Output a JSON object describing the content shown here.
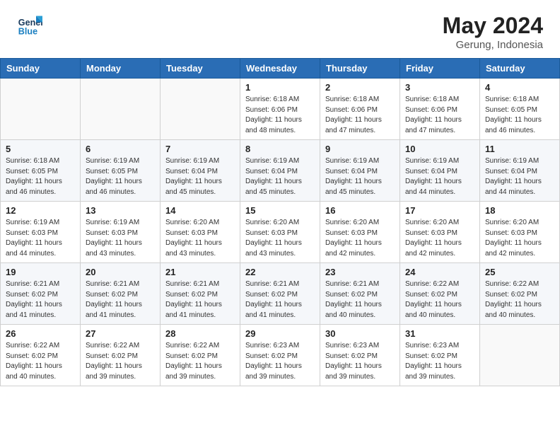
{
  "header": {
    "logo_line1": "General",
    "logo_line2": "Blue",
    "month_year": "May 2024",
    "location": "Gerung, Indonesia"
  },
  "weekdays": [
    "Sunday",
    "Monday",
    "Tuesday",
    "Wednesday",
    "Thursday",
    "Friday",
    "Saturday"
  ],
  "weeks": [
    [
      {
        "day": "",
        "info": ""
      },
      {
        "day": "",
        "info": ""
      },
      {
        "day": "",
        "info": ""
      },
      {
        "day": "1",
        "info": "Sunrise: 6:18 AM\nSunset: 6:06 PM\nDaylight: 11 hours\nand 48 minutes."
      },
      {
        "day": "2",
        "info": "Sunrise: 6:18 AM\nSunset: 6:06 PM\nDaylight: 11 hours\nand 47 minutes."
      },
      {
        "day": "3",
        "info": "Sunrise: 6:18 AM\nSunset: 6:06 PM\nDaylight: 11 hours\nand 47 minutes."
      },
      {
        "day": "4",
        "info": "Sunrise: 6:18 AM\nSunset: 6:05 PM\nDaylight: 11 hours\nand 46 minutes."
      }
    ],
    [
      {
        "day": "5",
        "info": "Sunrise: 6:18 AM\nSunset: 6:05 PM\nDaylight: 11 hours\nand 46 minutes."
      },
      {
        "day": "6",
        "info": "Sunrise: 6:19 AM\nSunset: 6:05 PM\nDaylight: 11 hours\nand 46 minutes."
      },
      {
        "day": "7",
        "info": "Sunrise: 6:19 AM\nSunset: 6:04 PM\nDaylight: 11 hours\nand 45 minutes."
      },
      {
        "day": "8",
        "info": "Sunrise: 6:19 AM\nSunset: 6:04 PM\nDaylight: 11 hours\nand 45 minutes."
      },
      {
        "day": "9",
        "info": "Sunrise: 6:19 AM\nSunset: 6:04 PM\nDaylight: 11 hours\nand 45 minutes."
      },
      {
        "day": "10",
        "info": "Sunrise: 6:19 AM\nSunset: 6:04 PM\nDaylight: 11 hours\nand 44 minutes."
      },
      {
        "day": "11",
        "info": "Sunrise: 6:19 AM\nSunset: 6:04 PM\nDaylight: 11 hours\nand 44 minutes."
      }
    ],
    [
      {
        "day": "12",
        "info": "Sunrise: 6:19 AM\nSunset: 6:03 PM\nDaylight: 11 hours\nand 44 minutes."
      },
      {
        "day": "13",
        "info": "Sunrise: 6:19 AM\nSunset: 6:03 PM\nDaylight: 11 hours\nand 43 minutes."
      },
      {
        "day": "14",
        "info": "Sunrise: 6:20 AM\nSunset: 6:03 PM\nDaylight: 11 hours\nand 43 minutes."
      },
      {
        "day": "15",
        "info": "Sunrise: 6:20 AM\nSunset: 6:03 PM\nDaylight: 11 hours\nand 43 minutes."
      },
      {
        "day": "16",
        "info": "Sunrise: 6:20 AM\nSunset: 6:03 PM\nDaylight: 11 hours\nand 42 minutes."
      },
      {
        "day": "17",
        "info": "Sunrise: 6:20 AM\nSunset: 6:03 PM\nDaylight: 11 hours\nand 42 minutes."
      },
      {
        "day": "18",
        "info": "Sunrise: 6:20 AM\nSunset: 6:03 PM\nDaylight: 11 hours\nand 42 minutes."
      }
    ],
    [
      {
        "day": "19",
        "info": "Sunrise: 6:21 AM\nSunset: 6:02 PM\nDaylight: 11 hours\nand 41 minutes."
      },
      {
        "day": "20",
        "info": "Sunrise: 6:21 AM\nSunset: 6:02 PM\nDaylight: 11 hours\nand 41 minutes."
      },
      {
        "day": "21",
        "info": "Sunrise: 6:21 AM\nSunset: 6:02 PM\nDaylight: 11 hours\nand 41 minutes."
      },
      {
        "day": "22",
        "info": "Sunrise: 6:21 AM\nSunset: 6:02 PM\nDaylight: 11 hours\nand 41 minutes."
      },
      {
        "day": "23",
        "info": "Sunrise: 6:21 AM\nSunset: 6:02 PM\nDaylight: 11 hours\nand 40 minutes."
      },
      {
        "day": "24",
        "info": "Sunrise: 6:22 AM\nSunset: 6:02 PM\nDaylight: 11 hours\nand 40 minutes."
      },
      {
        "day": "25",
        "info": "Sunrise: 6:22 AM\nSunset: 6:02 PM\nDaylight: 11 hours\nand 40 minutes."
      }
    ],
    [
      {
        "day": "26",
        "info": "Sunrise: 6:22 AM\nSunset: 6:02 PM\nDaylight: 11 hours\nand 40 minutes."
      },
      {
        "day": "27",
        "info": "Sunrise: 6:22 AM\nSunset: 6:02 PM\nDaylight: 11 hours\nand 39 minutes."
      },
      {
        "day": "28",
        "info": "Sunrise: 6:22 AM\nSunset: 6:02 PM\nDaylight: 11 hours\nand 39 minutes."
      },
      {
        "day": "29",
        "info": "Sunrise: 6:23 AM\nSunset: 6:02 PM\nDaylight: 11 hours\nand 39 minutes."
      },
      {
        "day": "30",
        "info": "Sunrise: 6:23 AM\nSunset: 6:02 PM\nDaylight: 11 hours\nand 39 minutes."
      },
      {
        "day": "31",
        "info": "Sunrise: 6:23 AM\nSunset: 6:02 PM\nDaylight: 11 hours\nand 39 minutes."
      },
      {
        "day": "",
        "info": ""
      }
    ]
  ]
}
